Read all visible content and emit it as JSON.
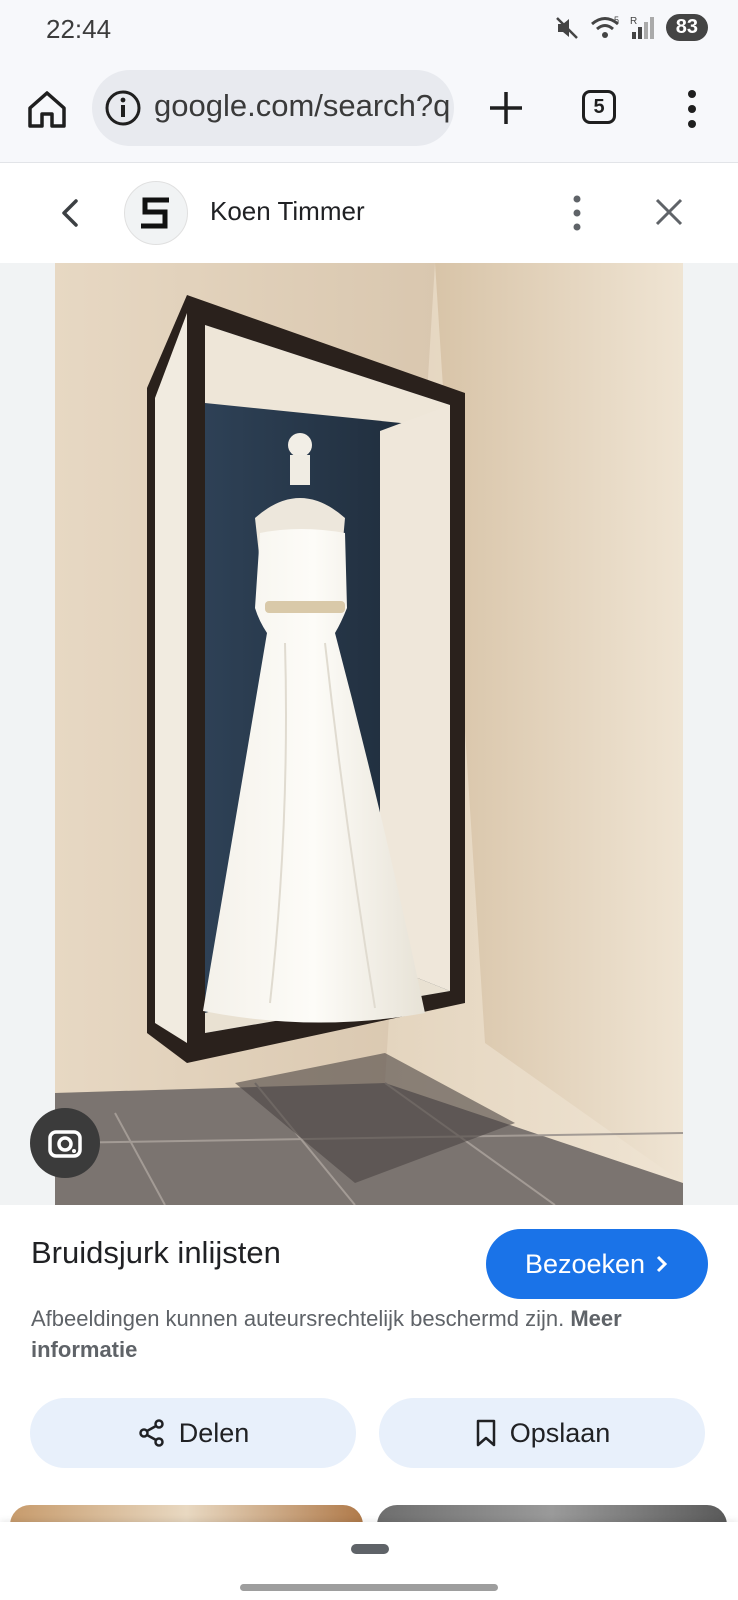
{
  "status_bar": {
    "time": "22:44",
    "network_label": "R",
    "signal_label": "5",
    "battery": "83"
  },
  "browser": {
    "url": "google.com/search?q=bruidsjurk+inlijsten",
    "tab_count": "5"
  },
  "viewer": {
    "source_name": "Koen Timmer",
    "image_title": "Bruidsjurk inlijsten",
    "visit_label": "Bezoeken",
    "copyright_notice": "Afbeeldingen kunnen auteursrechtelijk beschermd zijn.",
    "more_info_label": "Meer informatie",
    "share_label": "Delen",
    "save_label": "Opslaan"
  },
  "colors": {
    "accent": "#1a73e8",
    "action_bg": "#e8f0fb",
    "toolbar_bg": "#f7f8fb"
  }
}
